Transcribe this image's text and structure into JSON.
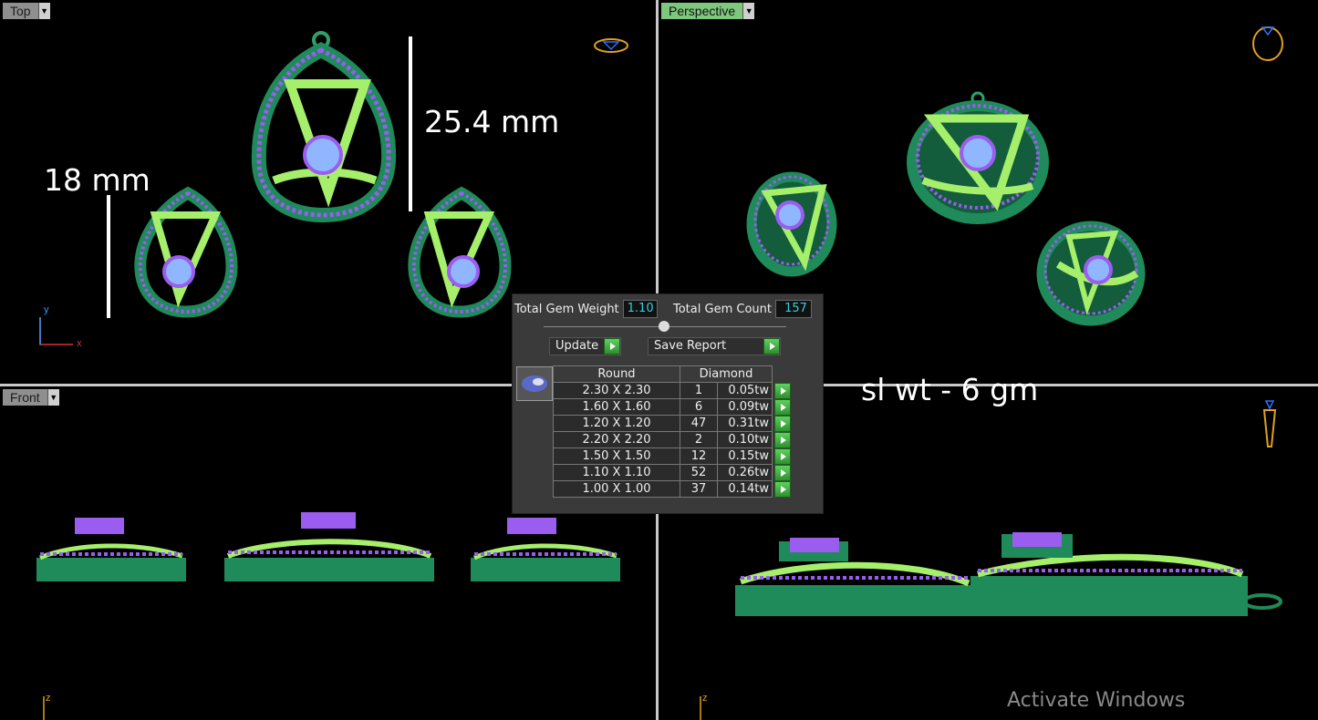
{
  "viewports": {
    "top": {
      "label": "Top"
    },
    "perspective": {
      "label": "Perspective"
    },
    "front": {
      "label": "Front"
    }
  },
  "annotations": {
    "height_large": "25.4 mm",
    "height_small": "18 mm",
    "silver_weight": "sl wt - 6 gm"
  },
  "axes": {
    "y": "y",
    "x": "x",
    "z1": "z",
    "z2": "z"
  },
  "gem_panel": {
    "total_weight_label": "Total Gem Weight",
    "total_weight_value": "1.10",
    "total_count_label": "Total Gem Count",
    "total_count_value": "157",
    "update_label": "Update",
    "save_report_label": "Save Report",
    "col_shape": "Round",
    "col_material": "Diamond",
    "rows": [
      {
        "size": "2.30 X 2.30",
        "count": "1",
        "weight": "0.05tw"
      },
      {
        "size": "1.60 X 1.60",
        "count": "6",
        "weight": "0.09tw"
      },
      {
        "size": "1.20 X 1.20",
        "count": "47",
        "weight": "0.31tw"
      },
      {
        "size": "2.20 X 2.20",
        "count": "2",
        "weight": "0.10tw"
      },
      {
        "size": "1.50 X 1.50",
        "count": "12",
        "weight": "0.15tw"
      },
      {
        "size": "1.10 X 1.10",
        "count": "52",
        "weight": "0.26tw"
      },
      {
        "size": "1.00 X 1.00",
        "count": "37",
        "weight": "0.14tw"
      }
    ]
  },
  "watermark": "Activate Windows",
  "colors": {
    "metal": "#1f8a5a",
    "highlight": "#a6ef6a",
    "gem": "#9b5cf0",
    "gem_light": "#8fb6ff"
  }
}
